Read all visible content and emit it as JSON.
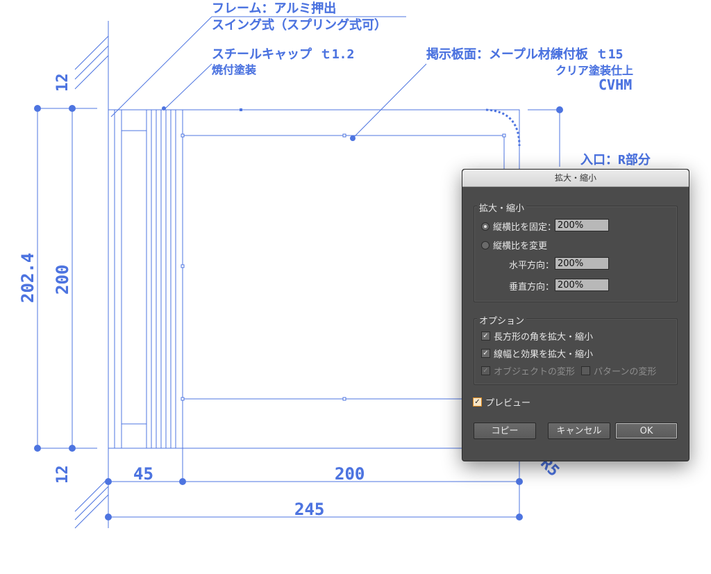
{
  "drawing": {
    "labels": {
      "frame_line1": "フレーム：アルミ押出",
      "frame_line2": "スイング式（スプリング式可）",
      "cap_line1": "スチールキャップ ｔ1.2",
      "cap_line2": "焼付塗装",
      "panel_line1": "掲示板面：メープル材練付板 ｔ15",
      "panel_line2": "クリア塗装仕上",
      "panel_line3": "CVHM",
      "corner": "入口：R部分",
      "d_12_top": "12",
      "d_12_bottom": "12",
      "d_2024": "202.4",
      "d_200_v": "200",
      "d_45": "45",
      "d_200_h": "200",
      "d_245": "245",
      "d_r5": "R5"
    }
  },
  "dialog": {
    "title": "拡大・縮小",
    "scale_group": {
      "label": "拡大・縮小",
      "uniform_label": "縦横比を固定：",
      "uniform_value": "200%",
      "nonuniform_label": "縦横比を変更",
      "horizontal_label": "水平方向：",
      "horizontal_value": "200%",
      "vertical_label": "垂直方向：",
      "vertical_value": "200%"
    },
    "options_group": {
      "label": "オプション",
      "scale_corners": "長方形の角を拡大・縮小",
      "scale_strokes": "線幅と効果を拡大・縮小",
      "transform_objects": "オブジェクトの変形",
      "transform_patterns": "パターンの変形"
    },
    "preview_label": "プレビュー",
    "buttons": {
      "copy": "コピー",
      "cancel": "キャンセル",
      "ok": "OK"
    }
  },
  "colors": {
    "drawing": "#4d74e0",
    "dialog_bg": "#4b4b4b",
    "preview_accent": "#e08b1f"
  }
}
